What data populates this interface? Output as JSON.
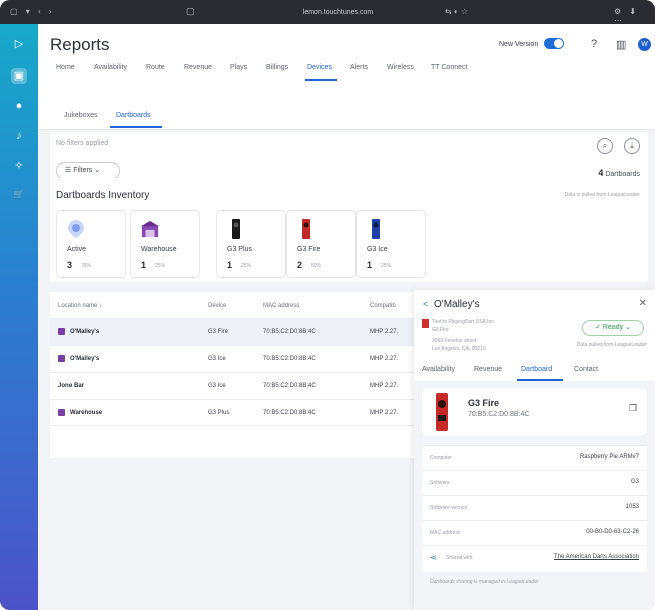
{
  "browser": {
    "url": "lemon.touchtunes.com",
    "tab_icon": "▢",
    "left_controls": "▢ ▾ ‹ ›",
    "right_controls": "⚙ ⬇ ⋯",
    "mid_controls": "⇆ ◐ ☆"
  },
  "rail": {
    "logo": "▷",
    "items": [
      "▣",
      "●",
      "♪",
      "✧",
      "🛒"
    ]
  },
  "header": {
    "title": "Reports",
    "new_version_label": "New Version",
    "help_icon": "?",
    "library_icon": "▥",
    "avatar_initial": "W"
  },
  "nav": {
    "items": [
      "Home",
      "Availability",
      "Route",
      "Revenue",
      "Plays",
      "Billings",
      "Devices",
      "Alerts",
      "Wireless",
      "TT Connect"
    ],
    "active": "Devices"
  },
  "subtabs": {
    "items": [
      "Jukeboxes",
      "Dartboards"
    ],
    "active": "Dartboards"
  },
  "filters": {
    "none_label": "No filters applied",
    "filter_button": "Filters",
    "count": "4",
    "count_label": "Dartboards"
  },
  "inventory": {
    "title": "Dartboards Inventory",
    "note": "Data is pulled from LeagueLeader",
    "cards": [
      {
        "label": "Active",
        "count": "3",
        "pct": "75%",
        "color": "#7f9ef0"
      },
      {
        "label": "Warehouse",
        "count": "1",
        "pct": "25%",
        "color": "#8a4ab3"
      },
      {
        "label": "G3 Plus",
        "count": "1",
        "pct": "25%",
        "color": "#1a1a1a"
      },
      {
        "label": "G3 Fire",
        "count": "2",
        "pct": "50%",
        "color": "#c62828"
      },
      {
        "label": "G3 Ice",
        "count": "1",
        "pct": "25%",
        "color": "#1e40a8"
      }
    ]
  },
  "table": {
    "headers": [
      "Location name ↓",
      "Device",
      "MAC address",
      "Compatib"
    ],
    "rows": [
      {
        "name": "O'Malley's",
        "device": "G3 Fire",
        "mac": "70:B5:C2:D0:8B:4C",
        "compat": "MHP 2.27.",
        "icon": true
      },
      {
        "name": "O'Malley's",
        "device": "G3 Ice",
        "mac": "70:B5:C2:D0:8B:4C",
        "compat": "MHP 2.27.",
        "icon": true
      },
      {
        "name": "Jono Bar",
        "device": "G3 Ice",
        "mac": "70:B5:C2:D0:8B:4C",
        "compat": "MHP 2.27.",
        "icon": false
      },
      {
        "name": "Warehouse",
        "device": "G3 Plus",
        "mac": "70:B5:C2:D0:8B:4C",
        "compat": "MHP 2.27.",
        "icon": true
      }
    ]
  },
  "panel": {
    "title": "O'Malley's",
    "address1": "Tied to PlayingDart USA Inc.",
    "address2": "G3 Fire",
    "address3": "3950 Fenelon street",
    "address4": "Los Angeles, CA, 90210",
    "ready": "Ready",
    "note": "Data pulled from LeagueLeader",
    "tabs": [
      "Availability",
      "Revenue",
      "Dartboard",
      "Contact"
    ],
    "active_tab": "Dartboard",
    "device_name": "G3 Fire",
    "device_mac": "70:B5:C2:D0:8B:4C",
    "info": [
      {
        "key": "Computer",
        "value": "Raspberry Pie ARMv7"
      },
      {
        "key": "Software",
        "value": "G3"
      },
      {
        "key": "Software version",
        "value": "1053"
      },
      {
        "key": "MAC address",
        "value": "00-B0-D0-63-C2-26"
      }
    ],
    "shared_label": "Shared with",
    "shared_value": "The American Darts Association",
    "footer": "Dartboards sharing is managed in LeagueLeader"
  }
}
